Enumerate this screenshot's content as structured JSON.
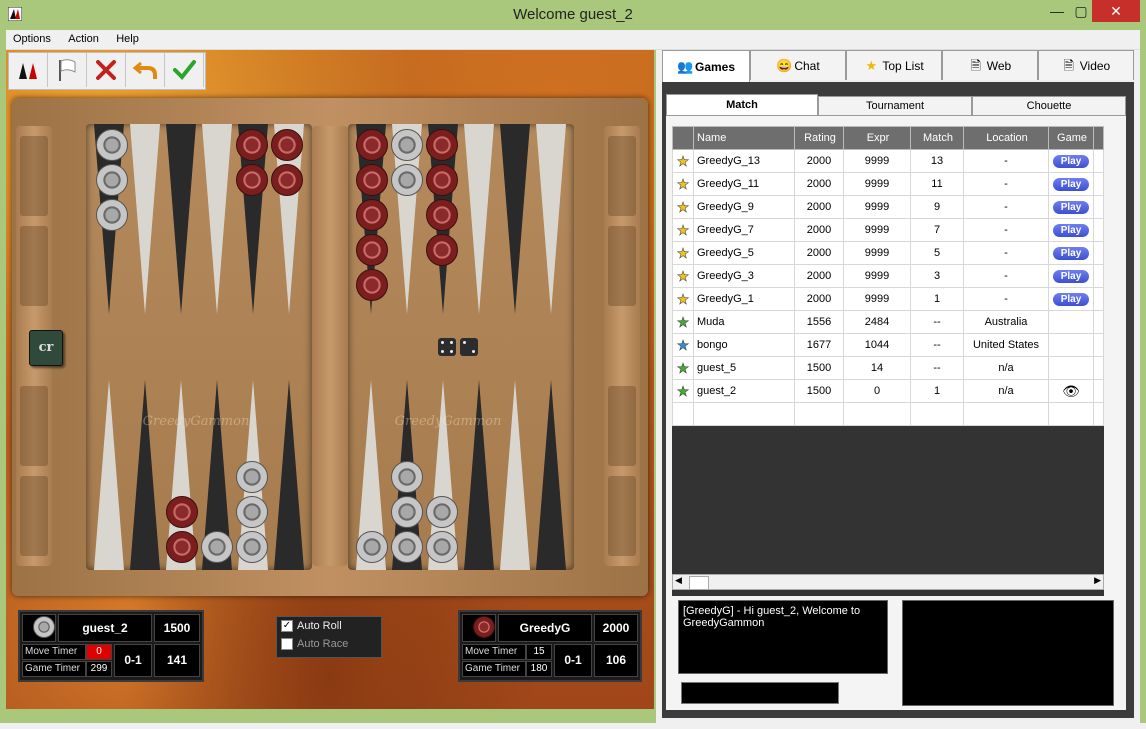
{
  "window": {
    "title": "Welcome guest_2",
    "minimize": "—",
    "maximize": "▢",
    "close": "✕"
  },
  "menu": [
    "Options",
    "Action",
    "Help"
  ],
  "toolbar": {
    "buttons": [
      "new-game",
      "resign-flag",
      "cancel",
      "undo",
      "confirm"
    ]
  },
  "board": {
    "watermark": "GreedyGammon",
    "cube_label": "cr",
    "dice": [
      4,
      2
    ]
  },
  "players": {
    "left": {
      "name": "guest_2",
      "rating": "1500",
      "move_timer_label": "Move Timer",
      "move_timer": "0",
      "game_timer_label": "Game Timer",
      "game_timer": "299",
      "score": "0-1",
      "pips": "141"
    },
    "right": {
      "name": "GreedyG",
      "rating": "2000",
      "move_timer_label": "Move Timer",
      "move_timer": "15",
      "game_timer_label": "Game Timer",
      "game_timer": "180",
      "score": "0-1",
      "pips": "106"
    }
  },
  "options": {
    "auto_roll": "Auto Roll",
    "auto_roll_checked": true,
    "auto_race": "Auto Race",
    "auto_race_checked": false
  },
  "tabs": [
    "Games",
    "Chat",
    "Top List",
    "Web",
    "Video"
  ],
  "subtabs": [
    "Match",
    "Tournament",
    "Chouette"
  ],
  "table": {
    "headers": [
      "Name",
      "Rating",
      "Expr",
      "Match",
      "Location",
      "Game"
    ],
    "rows": [
      {
        "star": "yellow",
        "name": "GreedyG_13",
        "rating": "2000",
        "expr": "9999",
        "match": "13",
        "location": "-",
        "game": "Play"
      },
      {
        "star": "yellow",
        "name": "GreedyG_11",
        "rating": "2000",
        "expr": "9999",
        "match": "11",
        "location": "-",
        "game": "Play"
      },
      {
        "star": "yellow",
        "name": "GreedyG_9",
        "rating": "2000",
        "expr": "9999",
        "match": "9",
        "location": "-",
        "game": "Play"
      },
      {
        "star": "yellow",
        "name": "GreedyG_7",
        "rating": "2000",
        "expr": "9999",
        "match": "7",
        "location": "-",
        "game": "Play"
      },
      {
        "star": "yellow",
        "name": "GreedyG_5",
        "rating": "2000",
        "expr": "9999",
        "match": "5",
        "location": "-",
        "game": "Play"
      },
      {
        "star": "yellow",
        "name": "GreedyG_3",
        "rating": "2000",
        "expr": "9999",
        "match": "3",
        "location": "-",
        "game": "Play"
      },
      {
        "star": "yellow",
        "name": "GreedyG_1",
        "rating": "2000",
        "expr": "9999",
        "match": "1",
        "location": "-",
        "game": "Play"
      },
      {
        "star": "green",
        "name": "Muda",
        "rating": "1556",
        "expr": "2484",
        "match": "--",
        "location": "Australia",
        "game": ""
      },
      {
        "star": "blue",
        "name": "bongo",
        "rating": "1677",
        "expr": "1044",
        "match": "--",
        "location": "United States",
        "game": ""
      },
      {
        "star": "green",
        "name": "guest_5",
        "rating": "1500",
        "expr": "14",
        "match": "--",
        "location": "n/a",
        "game": ""
      },
      {
        "star": "green",
        "name": "guest_2",
        "rating": "1500",
        "expr": "0",
        "match": "1",
        "location": "n/a",
        "game": "watch"
      }
    ]
  },
  "chat": {
    "message": "[GreedyG] - Hi guest_2, Welcome to GreedyGammon",
    "input_value": ""
  }
}
